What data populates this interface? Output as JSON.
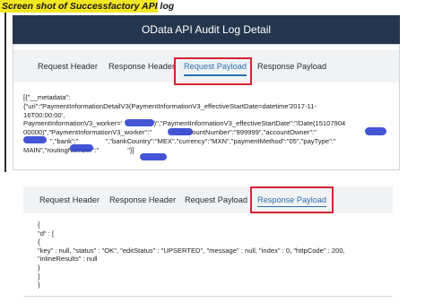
{
  "caption": "Screen shot of Successfactory API log",
  "dialog": {
    "title": "OData API Audit Log Detail"
  },
  "top_panel": {
    "tabs": [
      {
        "label": "Request Header"
      },
      {
        "label": "Response Header"
      },
      {
        "label": "Request Payload",
        "active": true
      },
      {
        "label": "Response Payload"
      }
    ],
    "lines": [
      "[{\"__metadata\":",
      "{\"uri\":\"PaymentInformationDetailV3(PaymentInformationV3_effectiveStartDate=datetime'2017-11-",
      "16T00:00:00',",
      "PaymentInformationV3_worker='",
      "')\",\"PaymentInformationV3_effectiveStartDate\":\"/Date(15107904",
      "00000)\",\"PaymentInformationV3_worker\":\"",
      "\",\"accountNumber\":\"999999\",\"accountOwner\":\"",
      "\",\"bank\":\"",
      "\",\"bankCountry\":\"MEX\",\"currency\":\"MXN\",\"paymentMethod\":\"05\",\"payType\":\"",
      "MAIN\",\"routingNumber\":\"",
      "\"}]"
    ]
  },
  "bottom_panel": {
    "tabs": [
      {
        "label": "Request Header"
      },
      {
        "label": "Response Header"
      },
      {
        "label": "Request Payload"
      },
      {
        "label": "Response Payload",
        "active": true
      }
    ],
    "lines": [
      "{",
      "\"d\" : [",
      "{",
      "\"key\" : null, \"status\" : \"OK\", \"editStatus\" : \"UPSERTED\", \"message\" : null, \"index\" : 0, \"httpCode\" : 200,",
      "\"inlineResults\" : null",
      "}",
      "]",
      "}"
    ]
  },
  "colors": {
    "header_bg": "#24364e",
    "highlight": "#d3232f",
    "active_tab": "#2a6fb0",
    "caption_bg": "#f3e623",
    "redaction": "#3446d2"
  }
}
